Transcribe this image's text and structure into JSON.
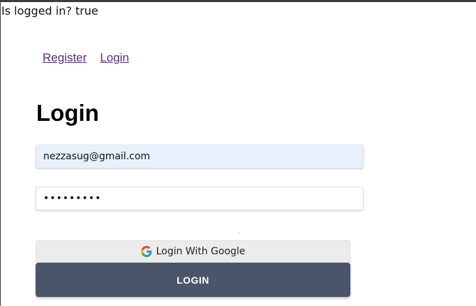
{
  "status": {
    "text": "Is logged in? true"
  },
  "nav": {
    "register_label": "Register",
    "login_label": "Login"
  },
  "form": {
    "title": "Login",
    "email_value": "nezzasug@gmail.com",
    "password_value": "•••••••••",
    "google_label": "Login With Google",
    "submit_label": "LOGIN"
  },
  "colors": {
    "link": "#5b2a86",
    "autofill_bg": "#e8f0fe",
    "submit_bg": "#4b5569",
    "google_bg": "#ececec"
  },
  "icons": {
    "google": "google-g-icon"
  }
}
